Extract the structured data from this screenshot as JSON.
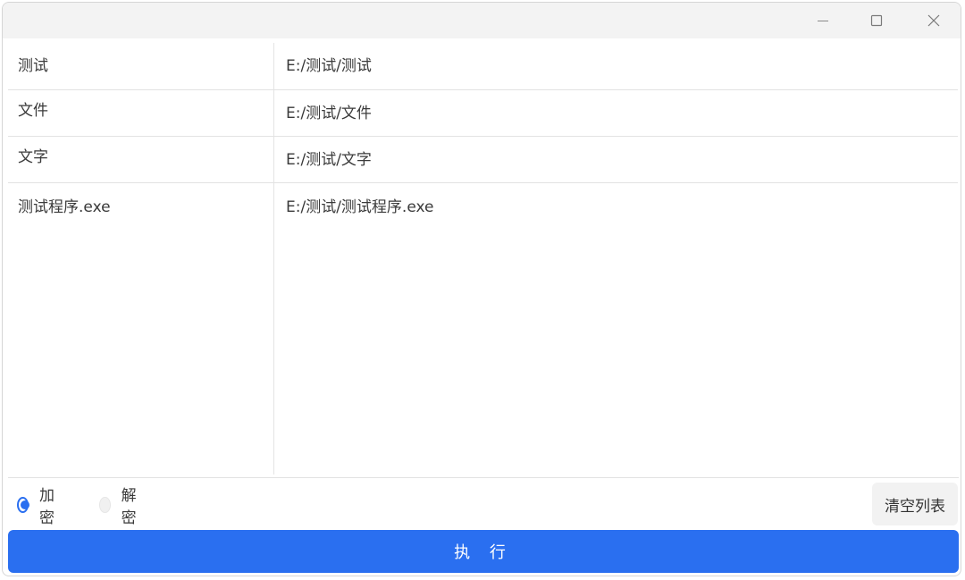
{
  "window": {
    "controls": [
      {
        "name": "minimize",
        "icon": "minimize-icon"
      },
      {
        "name": "maximize",
        "icon": "maximize-icon"
      },
      {
        "name": "close",
        "icon": "close-icon"
      }
    ]
  },
  "file_list": {
    "rows": [
      {
        "name": "测试",
        "path": "E:/测试/测试"
      },
      {
        "name": "文件",
        "path": "E:/测试/文件"
      },
      {
        "name": "文字",
        "path": "E:/测试/文字"
      },
      {
        "name": "测试程序.exe",
        "path": "E:/测试/测试程序.exe"
      }
    ]
  },
  "mode": {
    "options": [
      {
        "label": "加密",
        "checked": true
      },
      {
        "label": "解密",
        "checked": false
      }
    ]
  },
  "actions": {
    "clear_label": "清空列表",
    "execute_label": "执 行"
  },
  "colors": {
    "accent": "#2a6ff0",
    "titlebar": "#f3f3f3",
    "divider": "#e2e2e2"
  }
}
